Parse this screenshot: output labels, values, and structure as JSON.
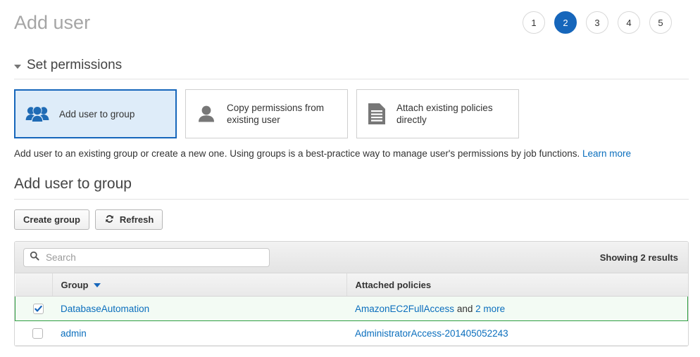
{
  "header": {
    "title": "Add user",
    "steps": [
      {
        "label": "1",
        "active": false
      },
      {
        "label": "2",
        "active": true
      },
      {
        "label": "3",
        "active": false
      },
      {
        "label": "4",
        "active": false
      },
      {
        "label": "5",
        "active": false
      }
    ]
  },
  "permissions_section": {
    "title": "Set permissions",
    "options": [
      {
        "label": "Add user to group",
        "icon": "users-group-icon",
        "selected": true
      },
      {
        "label": "Copy permissions from existing user",
        "icon": "user-icon",
        "selected": false
      },
      {
        "label": "Attach existing policies directly",
        "icon": "document-icon",
        "selected": false
      }
    ],
    "description": "Add user to an existing group or create a new one. Using groups is a best-practice way to manage user's permissions by job functions.",
    "learn_more": "Learn more"
  },
  "group_section": {
    "title": "Add user to group",
    "create_group_button": "Create group",
    "refresh_button": "Refresh",
    "refresh_icon": "refresh-icon",
    "search": {
      "placeholder": "Search",
      "value": "",
      "icon": "search-icon"
    },
    "results_text": "Showing 2 results",
    "table": {
      "columns": [
        "Group",
        "Attached policies"
      ],
      "sort_column": "Group",
      "sort_direction": "desc",
      "rows": [
        {
          "checked": true,
          "group": "DatabaseAutomation",
          "policy_link": "AmazonEC2FullAccess",
          "policy_and": "and",
          "policy_more": "2 more"
        },
        {
          "checked": false,
          "group": "admin",
          "policy_link": "AdministratorAccess-201405052243",
          "policy_and": "",
          "policy_more": ""
        }
      ]
    }
  },
  "colors": {
    "accent_blue": "#1666bb",
    "link_blue": "#0a6ebd",
    "selected_card_bg": "#deecf9",
    "selected_row_border": "#2e9e41",
    "selected_row_bg": "#f3fbf4",
    "title_gray": "#a5a5a5"
  }
}
